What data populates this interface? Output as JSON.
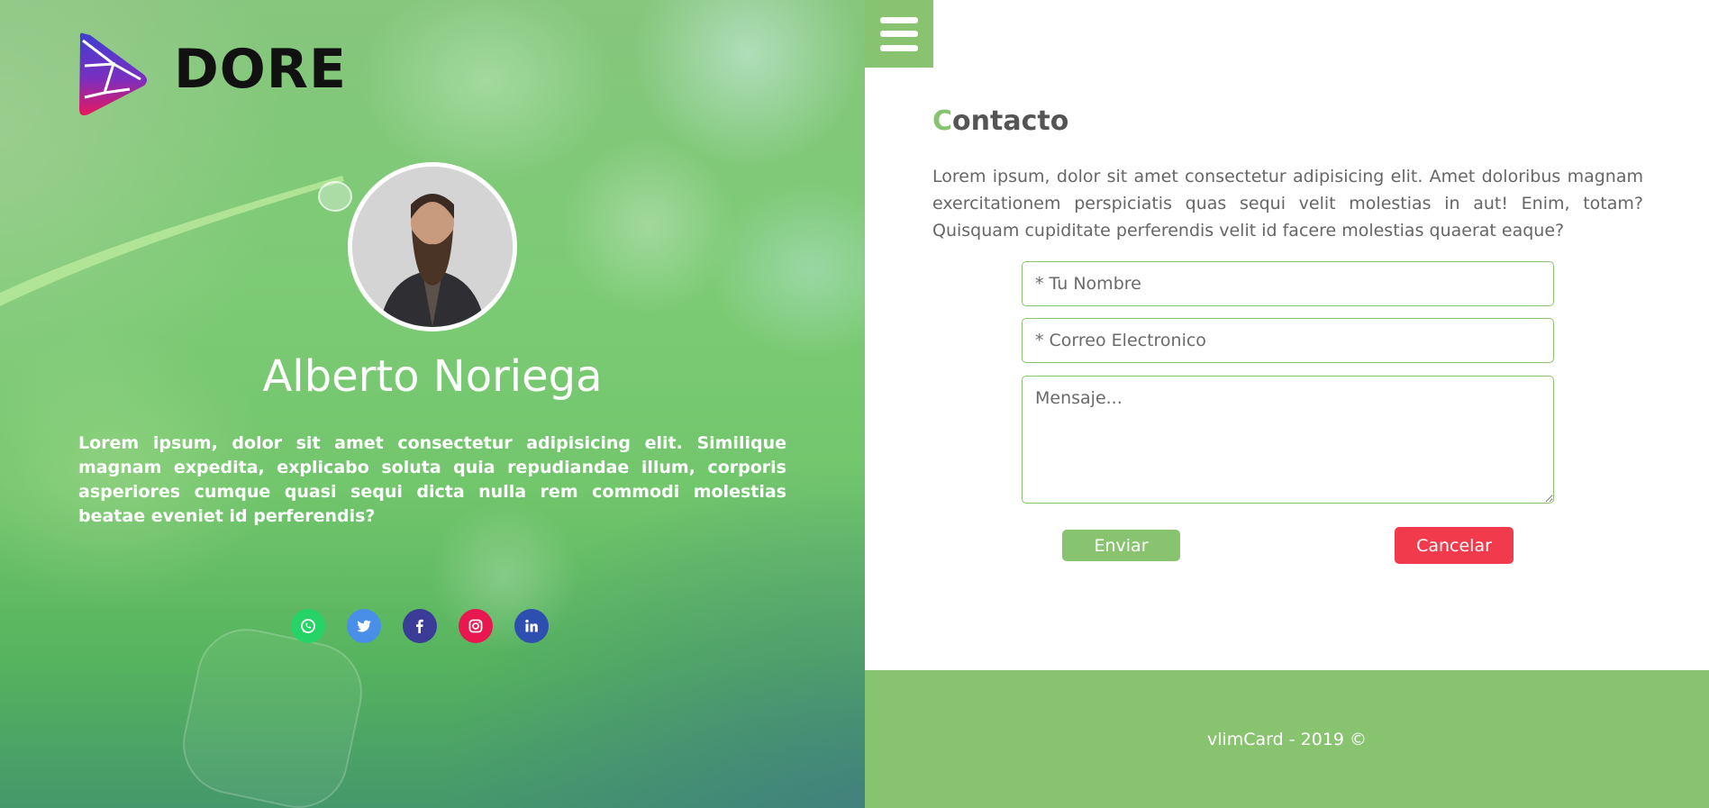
{
  "brand": {
    "name": "DORE"
  },
  "profile": {
    "name": "Alberto Noriega",
    "bio": "Lorem ipsum, dolor sit amet consectetur adipisicing elit. Similique magnam expedita, explicabo soluta quia repudiandae illum, corporis asperiores cumque quasi sequi dicta nulla rem commodi molestias beatae eveniet id perferendis?"
  },
  "socials": [
    {
      "name": "whatsapp",
      "icon": "whatsapp-icon",
      "color": "#25d366"
    },
    {
      "name": "twitter",
      "icon": "twitter-icon",
      "color": "#4a8fe7"
    },
    {
      "name": "facebook",
      "icon": "facebook-icon",
      "color": "#3b3b98"
    },
    {
      "name": "instagram",
      "icon": "instagram-icon",
      "color": "#e8174f"
    },
    {
      "name": "linkedin",
      "icon": "linkedin-icon",
      "color": "#2d4fb0"
    }
  ],
  "menu": {
    "icon": "hamburger-menu-icon"
  },
  "contact": {
    "title_first": "C",
    "title_rest": "ontacto",
    "description": "Lorem ipsum, dolor sit amet consectetur adipisicing elit. Amet doloribus magnam exercitationem perspiciatis quas sequi velit molestias in aut! Enim, totam? Quisquam cupiditate perferendis velit id facere molestias quaerat eaque?",
    "name_placeholder": "* Tu Nombre",
    "email_placeholder": "* Correo Electronico",
    "message_placeholder": "Mensaje...",
    "send_label": "Enviar",
    "cancel_label": "Cancelar"
  },
  "footer": {
    "text": "vlimCard - 2019 ©"
  },
  "colors": {
    "accent": "#88c370",
    "danger": "#f13a4b",
    "text": "#666666"
  }
}
